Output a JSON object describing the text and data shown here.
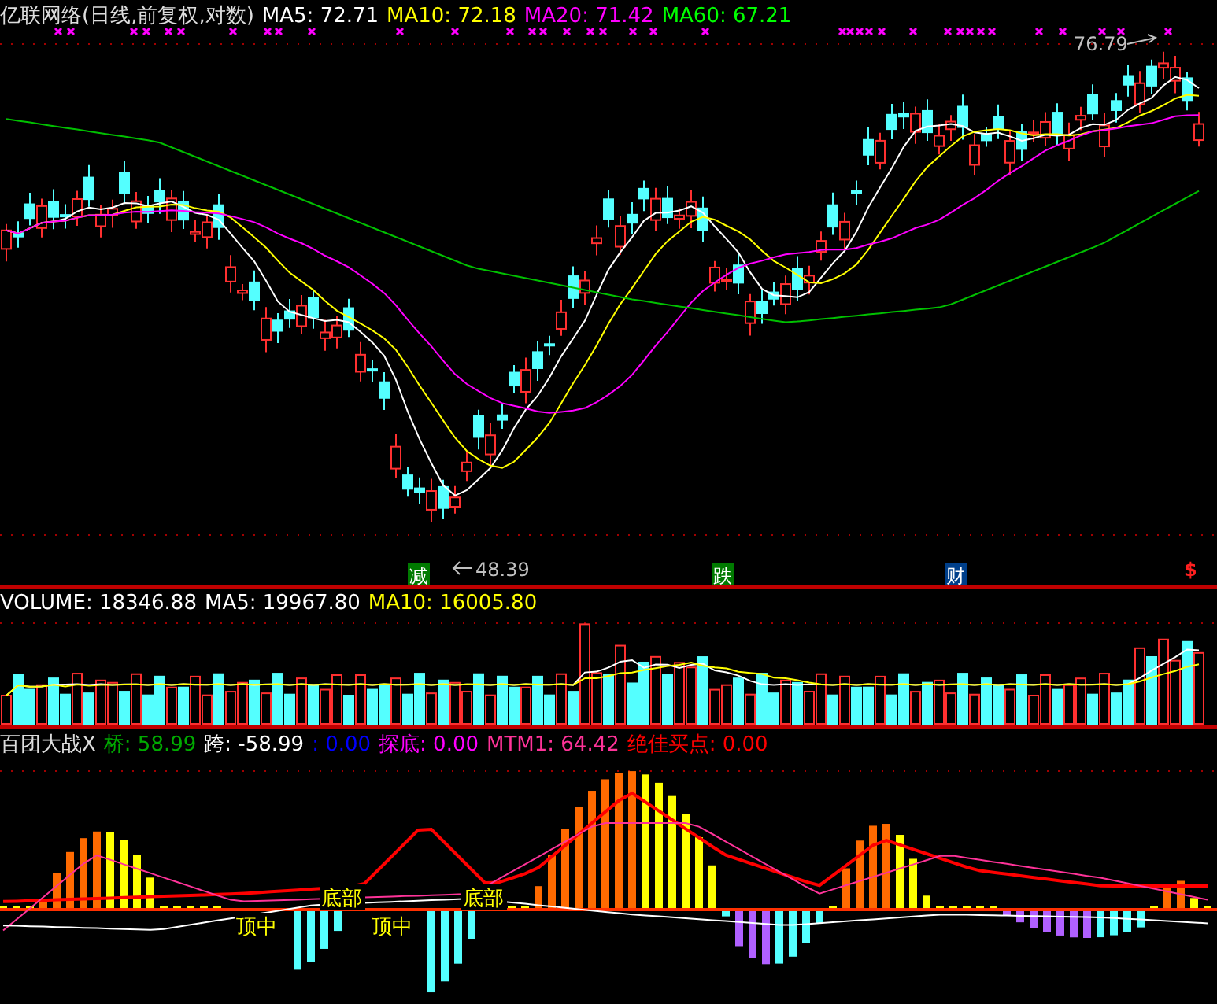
{
  "main_panel": {
    "title": "亿联网络(日线,前复权,对数)",
    "indicators": [
      {
        "label": "MA5: 72.71",
        "color": "#ffffff"
      },
      {
        "label": "MA10: 72.18",
        "color": "#ffff00"
      },
      {
        "label": "MA20: 71.42",
        "color": "#ff00ff"
      },
      {
        "label": "MA60: 67.21",
        "color": "#00ff00"
      }
    ],
    "high_label": "76.79",
    "low_label": "48.39",
    "signals": [
      {
        "text": "减",
        "color": "#007a00"
      },
      {
        "text": "跌",
        "color": "#007a00"
      },
      {
        "text": "财",
        "color": "#003f8a"
      }
    ],
    "dollar_mark": "$"
  },
  "volume_panel": {
    "indicators": [
      {
        "label": "VOLUME: 18346.88",
        "color": "#ffffff"
      },
      {
        "label": "MA5: 19967.80",
        "color": "#ffffff"
      },
      {
        "label": "MA10: 16005.80",
        "color": "#ffff00"
      }
    ]
  },
  "indicator_panel": {
    "title": "百团大战X",
    "indicators": [
      {
        "label": "桥: 58.99",
        "color": "#00aa00"
      },
      {
        "label": "跨: -58.99",
        "color": "#ffffff"
      },
      {
        "label": ": 0.00",
        "color": "#0000ff"
      },
      {
        "label": "探底: 0.00",
        "color": "#ff00ff"
      },
      {
        "label": "MTM1: 64.42",
        "color": "#ff3399"
      },
      {
        "label": "绝佳买点: 0.00",
        "color": "#ff0000"
      }
    ],
    "zone_labels": [
      {
        "text": "顶中",
        "color": "#ffff00"
      },
      {
        "text": "底部",
        "color": "#ffff00"
      },
      {
        "text": "顶中",
        "color": "#ffff00"
      },
      {
        "text": "底部",
        "color": "#ffff00"
      }
    ]
  }
}
